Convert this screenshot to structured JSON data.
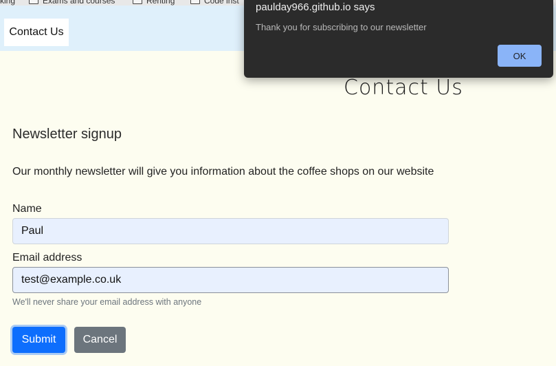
{
  "bookmarks": [
    {
      "label": "king",
      "has_folder_icon": false
    },
    {
      "label": "Exams and courses",
      "has_folder_icon": true
    },
    {
      "label": "Renting",
      "has_folder_icon": true
    },
    {
      "label": "Code inst",
      "has_folder_icon": true
    }
  ],
  "navbar": {
    "items": [
      {
        "label": "Contact Us",
        "active": true
      }
    ]
  },
  "page": {
    "title": "Contact Us",
    "section_heading": "Newsletter signup",
    "intro": "Our monthly newsletter will give you information about the coffee shops on our website"
  },
  "form": {
    "name": {
      "label": "Name",
      "value": "Paul"
    },
    "email": {
      "label": "Email address",
      "value": "test@example.co.uk",
      "help": "We'll never share your email address with anyone"
    },
    "submit_label": "Submit",
    "cancel_label": "Cancel"
  },
  "dialog": {
    "title": "paulday966.github.io says",
    "message": "Thank you for subscribing to our newsletter",
    "ok_label": "OK"
  },
  "colors": {
    "page_background": "#fdfdf0",
    "navbar_background": "#dff0fb",
    "primary": "#0d6efd",
    "secondary": "#6c757d",
    "dialog_background": "#2b2b2b",
    "dialog_button": "#8ab4f8"
  }
}
